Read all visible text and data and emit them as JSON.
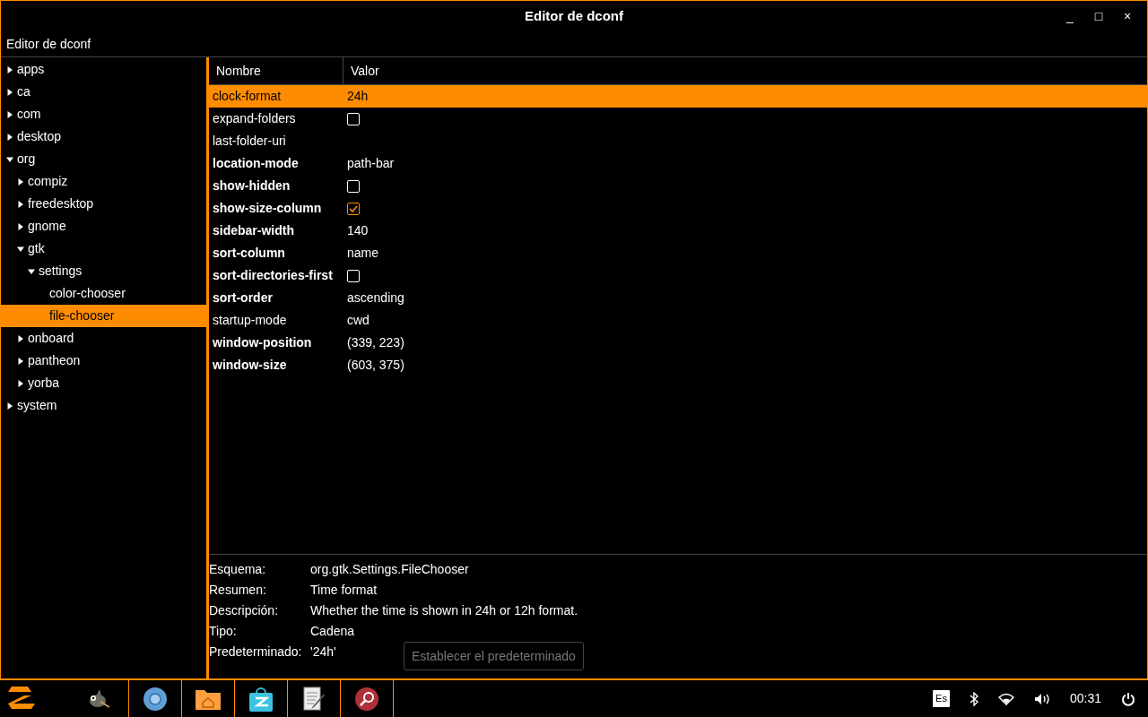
{
  "window": {
    "title": "Editor de dconf",
    "controls": [
      "_",
      "□",
      "×"
    ]
  },
  "header_title": "Editor de dconf",
  "tree": [
    {
      "label": "apps",
      "kind": "branch",
      "expanded": false,
      "selected": false
    },
    {
      "label": "ca",
      "kind": "branch",
      "expanded": false,
      "selected": false
    },
    {
      "label": "com",
      "kind": "branch",
      "expanded": false,
      "selected": false
    },
    {
      "label": "desktop",
      "kind": "branch",
      "expanded": false,
      "selected": false
    },
    {
      "label": "org",
      "kind": "branch",
      "expanded": true,
      "selected": false,
      "children": [
        {
          "label": "compiz",
          "kind": "branch",
          "expanded": false,
          "selected": false
        },
        {
          "label": "freedesktop",
          "kind": "branch",
          "expanded": false,
          "selected": false
        },
        {
          "label": "gnome",
          "kind": "branch",
          "expanded": false,
          "selected": false
        },
        {
          "label": "gtk",
          "kind": "branch",
          "expanded": true,
          "selected": false,
          "children": [
            {
              "label": "settings",
              "kind": "branch",
              "expanded": true,
              "selected": false,
              "children": [
                {
                  "label": "color-chooser",
                  "kind": "leaf",
                  "selected": false
                },
                {
                  "label": "file-chooser",
                  "kind": "leaf",
                  "selected": true
                }
              ]
            }
          ]
        },
        {
          "label": "onboard",
          "kind": "branch",
          "expanded": false,
          "selected": false
        },
        {
          "label": "pantheon",
          "kind": "branch",
          "expanded": false,
          "selected": false
        },
        {
          "label": "yorba",
          "kind": "branch",
          "expanded": false,
          "selected": false
        }
      ]
    },
    {
      "label": "system",
      "kind": "branch",
      "expanded": false,
      "selected": false
    }
  ],
  "table": {
    "columns": [
      "Nombre",
      "Valor"
    ],
    "rows": [
      {
        "name": "clock-format",
        "modified": false,
        "kind": "text",
        "value": "24h",
        "selected": true
      },
      {
        "name": "expand-folders",
        "modified": false,
        "kind": "checkbox",
        "checked": false,
        "selected": false
      },
      {
        "name": "last-folder-uri",
        "modified": false,
        "kind": "text",
        "value": "",
        "selected": false
      },
      {
        "name": "location-mode",
        "modified": true,
        "kind": "text",
        "value": "path-bar",
        "selected": false
      },
      {
        "name": "show-hidden",
        "modified": true,
        "kind": "checkbox",
        "checked": false,
        "selected": false
      },
      {
        "name": "show-size-column",
        "modified": true,
        "kind": "checkbox",
        "checked": true,
        "selected": false
      },
      {
        "name": "sidebar-width",
        "modified": true,
        "kind": "text",
        "value": "140",
        "selected": false
      },
      {
        "name": "sort-column",
        "modified": true,
        "kind": "text",
        "value": "name",
        "selected": false
      },
      {
        "name": "sort-directories-first",
        "modified": true,
        "kind": "checkbox",
        "checked": false,
        "selected": false
      },
      {
        "name": "sort-order",
        "modified": true,
        "kind": "text",
        "value": "ascending",
        "selected": false
      },
      {
        "name": "startup-mode",
        "modified": false,
        "kind": "text",
        "value": "cwd",
        "selected": false
      },
      {
        "name": "window-position",
        "modified": true,
        "kind": "text",
        "value": "(339, 223)",
        "selected": false
      },
      {
        "name": "window-size",
        "modified": true,
        "kind": "text",
        "value": "(603, 375)",
        "selected": false
      }
    ]
  },
  "details": [
    {
      "label": "Esquema:",
      "value": "org.gtk.Settings.FileChooser"
    },
    {
      "label": "Resumen:",
      "value": "Time format"
    },
    {
      "label": "Descripción:",
      "value": "Whether the time is shown in 24h or 12h format."
    },
    {
      "label": "Tipo:",
      "value": "Cadena"
    },
    {
      "label": "Predeterminado:",
      "value": "'24h'"
    }
  ],
  "default_button": {
    "label": "Establecer el predeterminado",
    "disabled": true
  },
  "taskbar": {
    "apps": [
      {
        "kind": "gimp"
      },
      {
        "kind": "browser"
      },
      {
        "kind": "files"
      },
      {
        "kind": "store"
      },
      {
        "kind": "editor"
      },
      {
        "kind": "search"
      }
    ],
    "keyboard": "Es",
    "clock": "00:31"
  }
}
